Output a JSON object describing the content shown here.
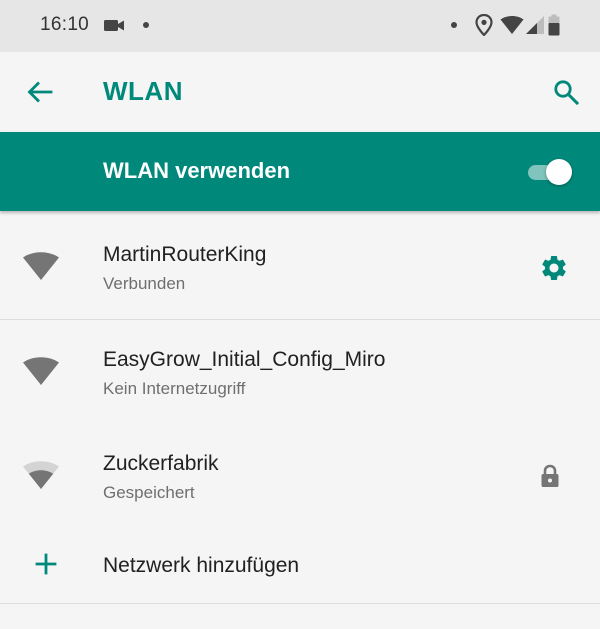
{
  "status_bar": {
    "time": "16:10",
    "icons": [
      "video-camera-icon",
      "notification-dot-icon",
      "notification-dot-icon",
      "location-icon",
      "wifi-status-icon",
      "cell-signal-icon",
      "battery-icon"
    ]
  },
  "app_bar": {
    "title": "WLAN",
    "back_icon": "arrow-back-icon",
    "search_icon": "search-icon",
    "accent_color": "#00897b"
  },
  "master_switch": {
    "label": "WLAN verwenden",
    "enabled": true,
    "background_color": "#00897b"
  },
  "networks": [
    {
      "name": "MartinRouterKing",
      "status": "Verbunden",
      "signal": "full",
      "secured": false,
      "action_icon": "gear-icon"
    },
    {
      "name": "EasyGrow_Initial_Config_Miro",
      "status": "Kein Internetzugriff",
      "signal": "full",
      "secured": false
    },
    {
      "name": "Zuckerfabrik",
      "status": "Gespeichert",
      "signal": "medium",
      "secured": true,
      "action_icon": "lock-icon"
    }
  ],
  "add_network": {
    "label": "Netzwerk hinzufügen",
    "icon": "plus-icon"
  }
}
